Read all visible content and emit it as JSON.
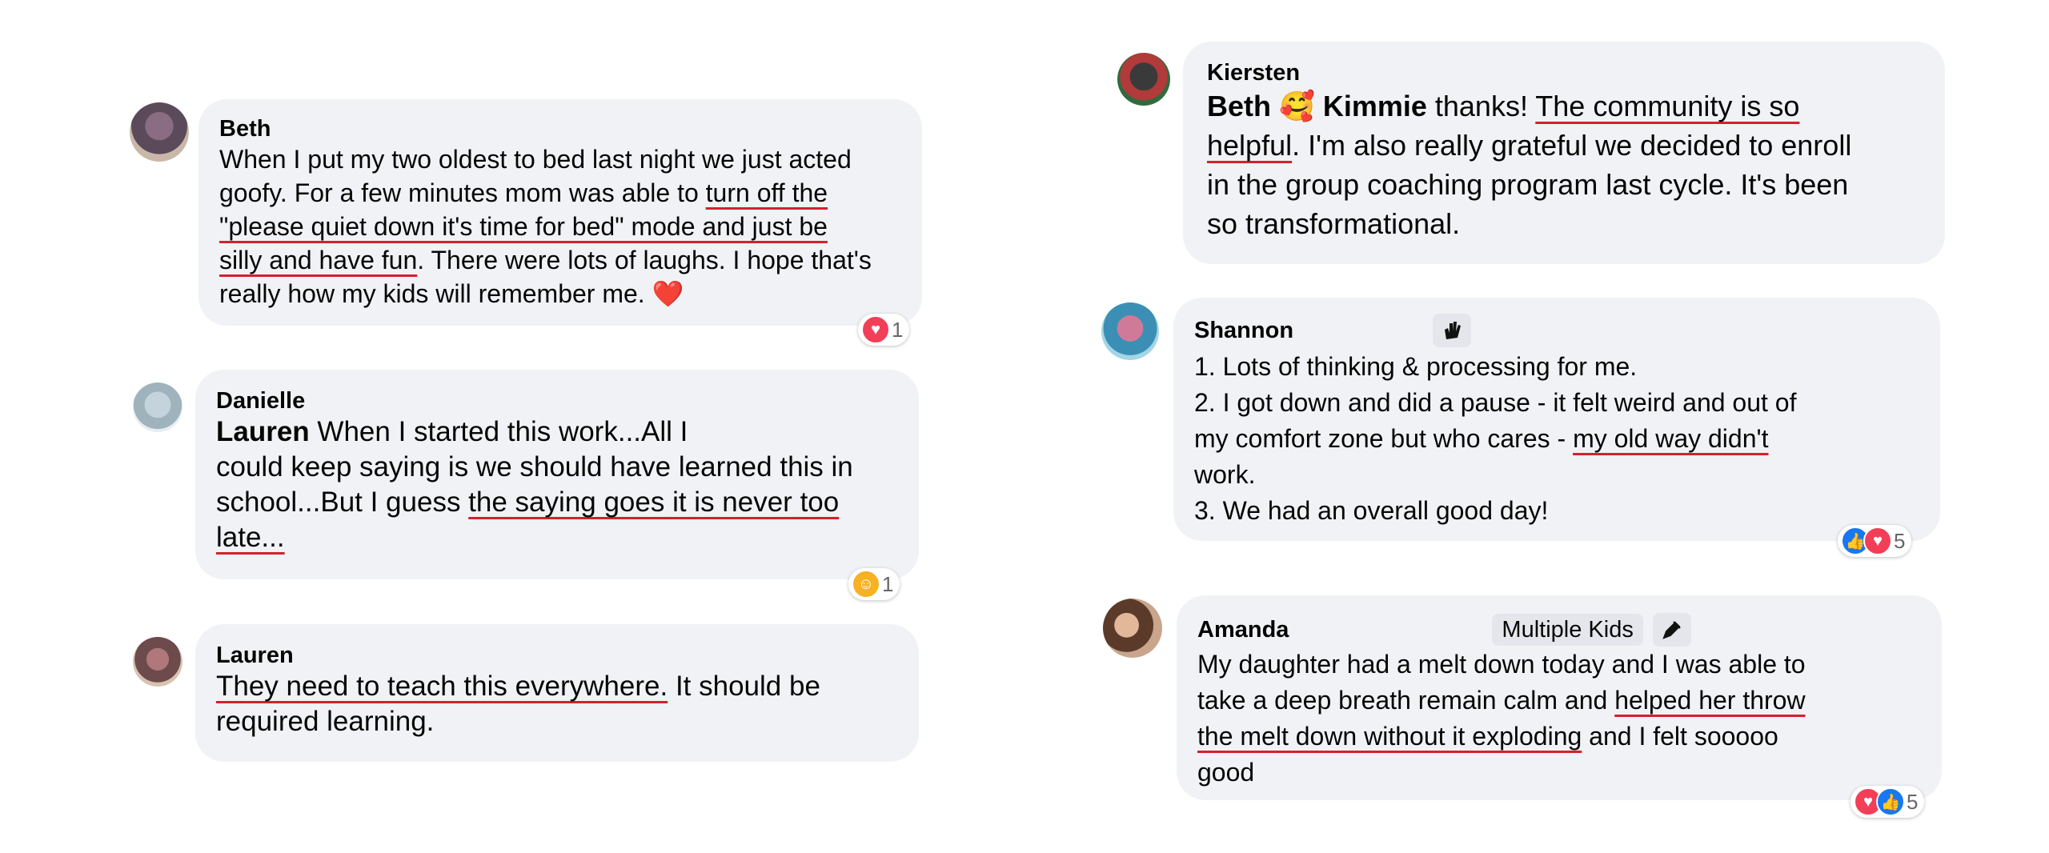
{
  "comments": [
    {
      "author": "Beth",
      "lines": [
        [
          {
            "t": "When I put my two oldest to bed last night we just acted"
          }
        ],
        [
          {
            "t": "goofy. For a few minutes mom was able to "
          },
          {
            "t": "turn off the",
            "u": true
          }
        ],
        [
          {
            "t": "\"please quiet down it's time for bed\" mode and just be",
            "u": true
          }
        ],
        [
          {
            "t": "silly and have fun",
            "u": true
          },
          {
            "t": ". There were lots of laughs. I hope that's"
          }
        ],
        [
          {
            "t": "really how my kids will remember me. ❤️"
          }
        ]
      ],
      "reactions": {
        "icons": [
          "love-icon"
        ],
        "count": "1"
      }
    },
    {
      "author": "Danielle",
      "lines": [
        [
          {
            "t": "Lauren",
            "b": true
          },
          {
            "t": "             When I started this work...All I"
          }
        ],
        [
          {
            "t": "could keep saying is we should have learned this in"
          }
        ],
        [
          {
            "t": "school...But I guess "
          },
          {
            "t": "the saying goes it is never too",
            "u": true
          }
        ],
        [
          {
            "t": "late...",
            "u": true
          }
        ]
      ],
      "reactions": {
        "icons": [
          "care-icon"
        ],
        "count": "1"
      }
    },
    {
      "author": "Lauren",
      "lines": [
        [
          {
            "t": "They need to teach this everywhere.",
            "u": true
          },
          {
            "t": " It should be"
          }
        ],
        [
          {
            "t": "required learning."
          }
        ]
      ]
    },
    {
      "author": "Kiersten",
      "lines": [
        [
          {
            "t": "Beth",
            "b": true
          },
          {
            "t": " 🥰 "
          },
          {
            "t": "Kimmie",
            "b": true
          },
          {
            "t": " thanks! "
          },
          {
            "t": "The community is so",
            "u": true
          }
        ],
        [
          {
            "t": "helpful",
            "u": true
          },
          {
            "t": ". I'm also really grateful we decided to enroll"
          }
        ],
        [
          {
            "t": "in the group coaching program last cycle. It's been"
          }
        ],
        [
          {
            "t": "so transformational."
          }
        ]
      ]
    },
    {
      "author": "Shannon",
      "author_badge_icon": "waving-hand-icon",
      "lines": [
        [
          {
            "t": "1. Lots of thinking & processing for me."
          }
        ],
        [
          {
            "t": "2. I got down and did a pause - it felt weird and out of"
          }
        ],
        [
          {
            "t": "my comfort zone but who cares - "
          },
          {
            "t": "my old way didn't",
            "u": true
          }
        ],
        [
          {
            "t": "work."
          }
        ],
        [
          {
            "t": "3. We had an overall good day!"
          }
        ]
      ],
      "reactions": {
        "icons": [
          "like-icon",
          "love-icon"
        ],
        "count": "5"
      }
    },
    {
      "author": "Amanda",
      "author_badge": "Multiple Kids",
      "author_badge_icon": "pen-icon",
      "lines": [
        [
          {
            "t": "My daughter had a melt down today and I was able to"
          }
        ],
        [
          {
            "t": "take a deep breath remain calm and "
          },
          {
            "t": "helped her throw",
            "u": true
          }
        ],
        [
          {
            "t": "the melt down without it exploding",
            "u": true
          },
          {
            "t": " and I felt sooooo"
          }
        ],
        [
          {
            "t": "good"
          }
        ]
      ],
      "reactions": {
        "icons": [
          "love-icon",
          "like-icon"
        ],
        "count": "5"
      }
    }
  ],
  "colors": {
    "bubble": "#f0f2f5",
    "underline": "#d3212d",
    "like": "#1877f2",
    "love": "#f33e58",
    "care": "#f7b125"
  }
}
